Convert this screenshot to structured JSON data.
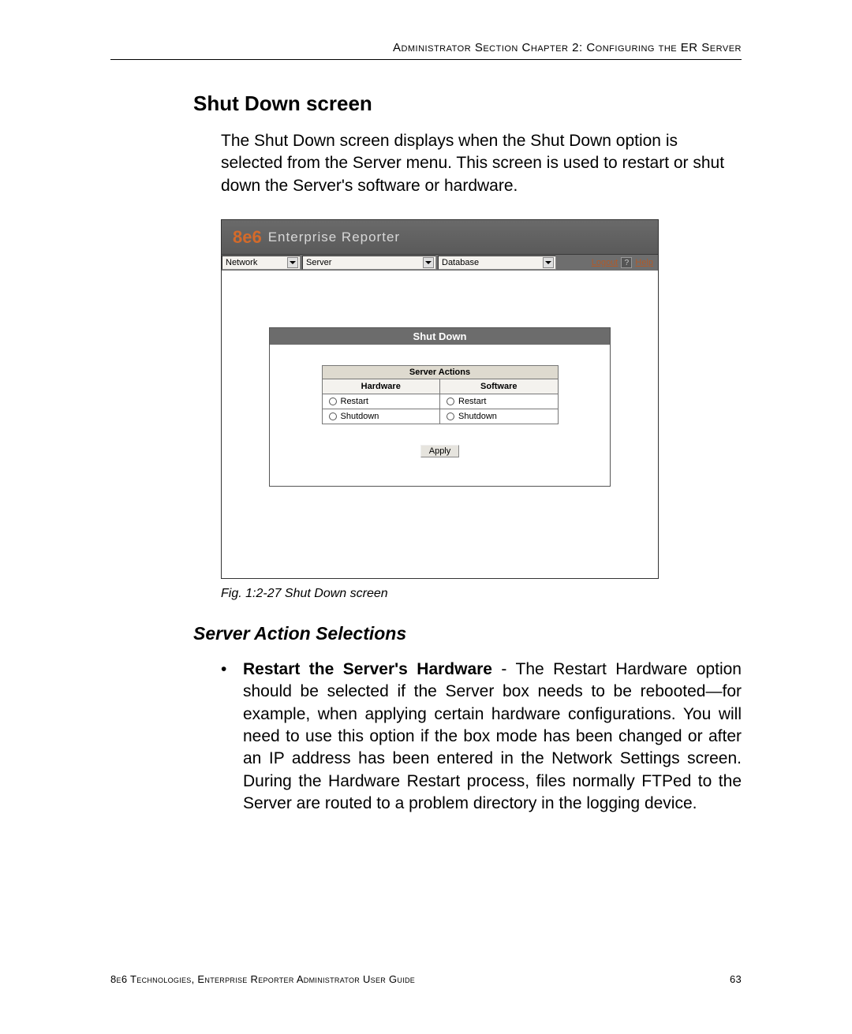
{
  "header": {
    "running_head": "Administrator Section  Chapter 2: Configuring the ER Server"
  },
  "section": {
    "title": "Shut Down screen",
    "intro": "The Shut Down screen displays when the Shut Down option is selected from the Server menu. This screen is used to restart or shut down the Server's software or hardware."
  },
  "screenshot": {
    "brand_8e6": "8e6",
    "brand_title": "Enterprise Reporter",
    "menus": {
      "network": "Network",
      "server": "Server",
      "database": "Database"
    },
    "links": {
      "logout": "Logout",
      "help_icon": "?",
      "help": "Help"
    },
    "panel_title": "Shut Down",
    "actions_header": "Server Actions",
    "cols": {
      "hardware": "Hardware",
      "software": "Software"
    },
    "options": {
      "hw_restart": "Restart",
      "hw_shutdown": "Shutdown",
      "sw_restart": "Restart",
      "sw_shutdown": "Shutdown"
    },
    "apply": "Apply"
  },
  "figure_caption": "Fig. 1:2-27  Shut Down screen",
  "subsection": {
    "title": "Server Action Selections",
    "bullet": "•",
    "item_bold": "Restart the Server's Hardware",
    "item_sep": " - ",
    "item_body": "The Restart Hardware option should be selected if the Server box needs to be rebooted—for example, when applying certain hardware configurations. You will need to use this option if the box mode has been changed or after an IP address has been entered in the Network Settings screen. During the Hardware Restart process, files normally FTPed to the Server are routed to a problem directory in the logging device."
  },
  "footer": {
    "left": "8e6 Technologies, Enterprise Reporter Administrator User Guide",
    "right": "63"
  }
}
